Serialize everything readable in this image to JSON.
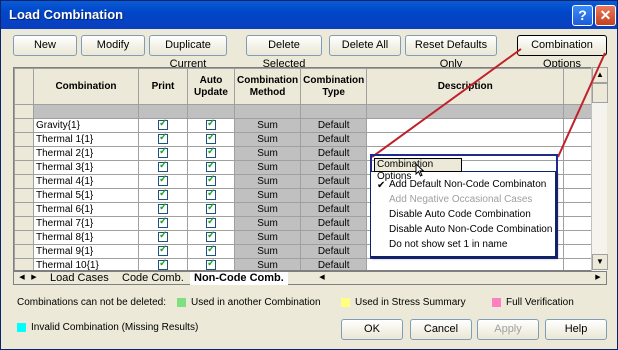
{
  "window": {
    "title": "Load Combination",
    "help_glyph": "?",
    "close_glyph": "✕"
  },
  "toolbar": {
    "new": "New",
    "modify": "Modify",
    "duplicate": "Duplicate Current",
    "delete_selected": "Delete Selected",
    "delete_all": "Delete All",
    "reset_defaults": "Reset Defaults Only",
    "combination_options": "Combination Options"
  },
  "grid": {
    "headers": {
      "combination": "Combination",
      "print": "Print",
      "auto_update": "Auto Update",
      "method": "Combination Method",
      "type": "Combination Type",
      "description": "Description"
    },
    "rows": [
      {
        "name": "Gravity{1}",
        "method": "Sum",
        "type": "Default"
      },
      {
        "name": "Thermal 1{1}",
        "method": "Sum",
        "type": "Default"
      },
      {
        "name": "Thermal 2{1}",
        "method": "Sum",
        "type": "Default"
      },
      {
        "name": "Thermal 3{1}",
        "method": "Sum",
        "type": "Default"
      },
      {
        "name": "Thermal 4{1}",
        "method": "Sum",
        "type": "Default"
      },
      {
        "name": "Thermal 5{1}",
        "method": "Sum",
        "type": "Default"
      },
      {
        "name": "Thermal 6{1}",
        "method": "Sum",
        "type": "Default"
      },
      {
        "name": "Thermal 7{1}",
        "method": "Sum",
        "type": "Default"
      },
      {
        "name": "Thermal 8{1}",
        "method": "Sum",
        "type": "Default"
      },
      {
        "name": "Thermal 9{1}",
        "method": "Sum",
        "type": "Default"
      },
      {
        "name": "Thermal 10{1}",
        "method": "Sum",
        "type": "Default"
      }
    ]
  },
  "tabs": [
    "Load Cases",
    "Code Comb.",
    "Non-Code Comb."
  ],
  "active_tab": "Non-Code Comb.",
  "legend": {
    "note": "Combinations can not be deleted:",
    "items": [
      {
        "label": "Used in another Combination",
        "color": "#7fe07f"
      },
      {
        "label": "Used in Stress Summary",
        "color": "#ffff80"
      },
      {
        "label": "Full Verification",
        "color": "#ff80c0"
      },
      {
        "label": "Invalid Combination (Missing Results)",
        "color": "#00ffff"
      }
    ]
  },
  "footer": {
    "ok": "OK",
    "cancel": "Cancel",
    "apply": "Apply",
    "help": "Help"
  },
  "popup": {
    "button": "Combination Options",
    "items": [
      {
        "label": "Add Default Non-Code Combinaton",
        "checked": true,
        "enabled": true
      },
      {
        "label": "Add Negative Occasional Cases",
        "checked": false,
        "enabled": false
      },
      {
        "label": "Disable Auto Code Combination",
        "checked": false,
        "enabled": true
      },
      {
        "label": "Disable Auto Non-Code Combination",
        "checked": false,
        "enabled": true
      },
      {
        "label": "Do not show set 1 in name",
        "checked": false,
        "enabled": true
      }
    ]
  },
  "colors": {
    "callout": "#c0202a",
    "frame": "#1f2a8c",
    "titlebar": "#0046c8"
  }
}
